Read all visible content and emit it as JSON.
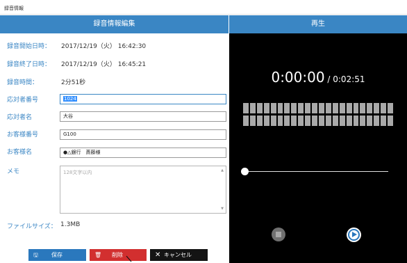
{
  "window": {
    "title": "録音情報"
  },
  "headers": {
    "edit": "録音情報編集",
    "playback": "再生"
  },
  "fields": {
    "start": {
      "label": "録音開始日時：",
      "value": "2017/12/19（火） 16:42:30"
    },
    "end": {
      "label": "録音終了日時：",
      "value": "2017/12/19（火） 16:45:21"
    },
    "duration": {
      "label": "録音時間：",
      "value": "2分51秒"
    },
    "responder_no": {
      "label": "応対者番号",
      "value": "1024"
    },
    "responder_name": {
      "label": "応対者名",
      "value": "大谷"
    },
    "customer_no": {
      "label": "お客様番号",
      "value": "G100"
    },
    "customer_name": {
      "label": "お客様名",
      "value": "●△銀行　斎藤様"
    },
    "memo": {
      "label": "メモ",
      "placeholder": "128文字以内",
      "value": ""
    },
    "file_size": {
      "label": "ファイルサイズ：",
      "value": "1.3MB"
    }
  },
  "buttons": {
    "save": "保存",
    "delete": "削除",
    "cancel": "キャンセル"
  },
  "player": {
    "current_time": "0:00:00",
    "separator": " / ",
    "total_time": "0:02:51",
    "progress": 0.0
  },
  "icons": {
    "save": "floppy-disk-icon",
    "delete": "trash-icon",
    "cancel": "close-icon",
    "stop": "stop-icon",
    "play": "play-icon"
  },
  "colors": {
    "accent": "#3a86c4",
    "save": "#2a78bd",
    "delete": "#d22f2f",
    "cancel": "#141414",
    "player_bg": "#000000"
  }
}
